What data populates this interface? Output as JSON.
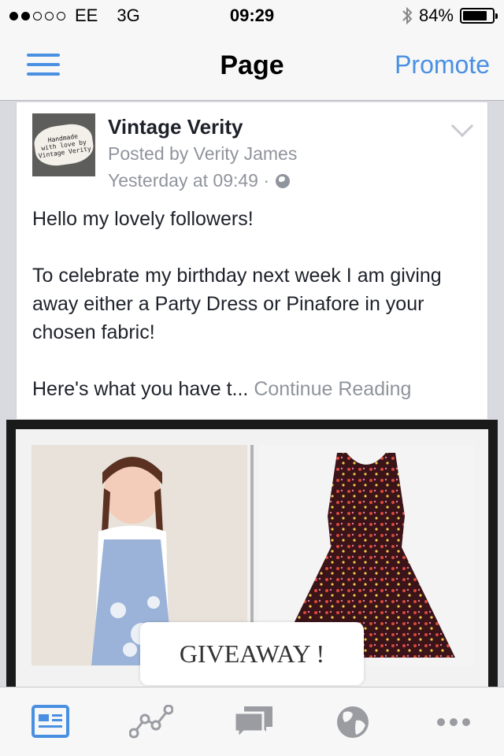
{
  "status_bar": {
    "carrier": "EE",
    "network": "3G",
    "time": "09:29",
    "battery": "84%",
    "battery_level": 0.84
  },
  "nav": {
    "title": "Page",
    "promote": "Promote"
  },
  "post": {
    "page_name": "Vintage Verity",
    "posted_by": "Posted by Verity James",
    "time": "Yesterday at 09:49 ·",
    "avatar_text": [
      "Handmade",
      "with love by",
      "Vintage Verity"
    ],
    "paragraphs": [
      "Hello my lovely followers!",
      "To celebrate my birthday next week I am giving away either a Party Dress or Pinafore in your chosen fabric!"
    ],
    "excerpt": "Here's what you have t... ",
    "continue_reading": "Continue Reading"
  },
  "image": {
    "caption": "GIVEAWAY !"
  },
  "tabs": [
    "news-feed-icon",
    "insights-icon",
    "messages-icon",
    "globe-icon",
    "more-icon"
  ],
  "colors": {
    "accent": "#4a90e2",
    "secondary_text": "#90949c"
  }
}
